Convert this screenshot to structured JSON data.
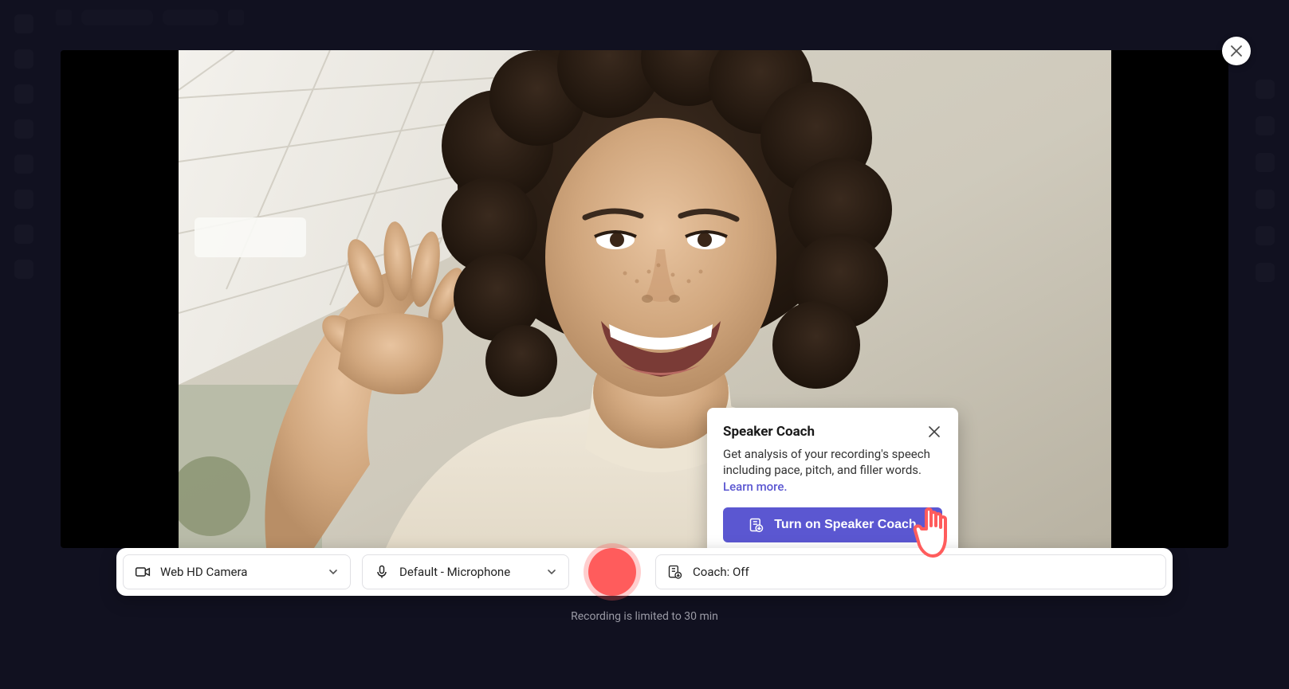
{
  "close": {
    "name": "close"
  },
  "controls": {
    "camera": {
      "label": "Web HD Camera"
    },
    "mic": {
      "label": "Default - Microphone"
    },
    "coach": {
      "label": "Coach: Off"
    }
  },
  "popover": {
    "title": "Speaker Coach",
    "body": "Get analysis of your recording's speech including pace, pitch, and filler words.",
    "link": "Learn more.",
    "button": "Turn on Speaker Coach"
  },
  "hint": "Recording is limited to 30 min"
}
